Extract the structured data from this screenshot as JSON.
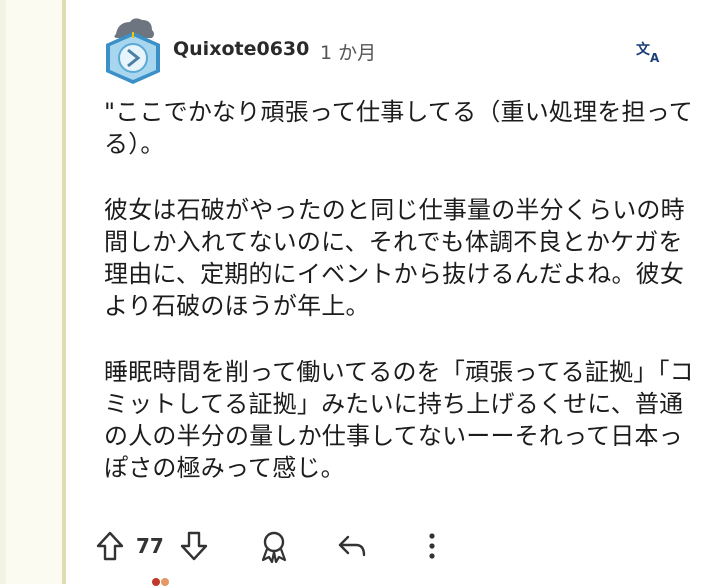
{
  "comment": {
    "username": "Quixote0630",
    "timestamp": "1 か月",
    "paragraphs": [
      "\"ここでかなり頑張って仕事してる（重い処理を担ってる）。",
      "彼女は石破がやったのと同じ仕事量の半分くらいの時間しか入れてないのに、それでも体調不良とかケガを理由に、定期的にイベントから抜けるんだよね。彼女より石破のほうが年上。",
      "睡眠時間を削って働いてるのを「頑張ってる証拠」「コミットしてる証拠」みたいに持ち上げるくせに、普通の人の半分の量しか仕事してないーーそれって日本っぽさの極みって感じ。"
    ]
  },
  "actions": {
    "vote_count": "77"
  },
  "icons": {
    "avatar": "avatar-icon",
    "translate": "translate-icon",
    "upvote": "arrow-up-icon",
    "downvote": "arrow-down-icon",
    "award": "award-icon",
    "reply": "reply-icon",
    "more": "more-dots-icon"
  },
  "colors": {
    "thread_line": "#dedeb0",
    "left_background": "#fbfbf2",
    "text": "#1c1c1c",
    "muted": "#555555"
  }
}
